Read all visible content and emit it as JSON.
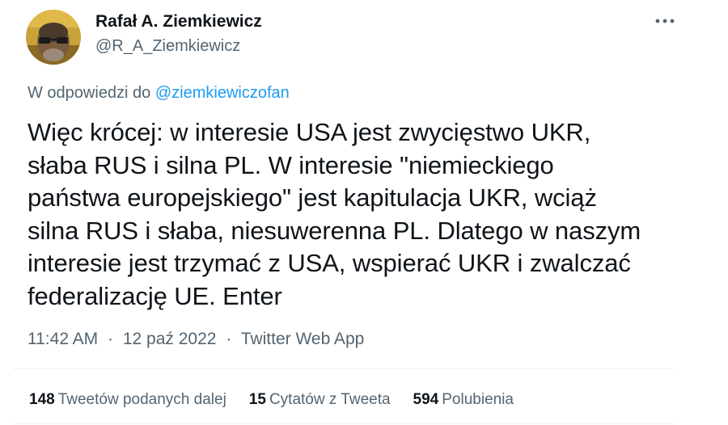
{
  "author": {
    "display_name": "Rafał A. Ziemkiewicz",
    "handle": "@R_A_Ziemkiewicz"
  },
  "reply_context": {
    "prefix": "W odpowiedzi do ",
    "mention": "@ziemkiewiczofan"
  },
  "tweet": {
    "lines": [
      "Więc krócej: w interesie USA jest zwycięstwo UKR,",
      "słaba RUS i silna PL. W interesie \"niemieckiego",
      "państwa europejskiego\" jest kapitulacja UKR, wciąż",
      "silna RUS i słaba, niesuwerenna PL. Dlatego w naszym",
      "interesie jest trzymać z USA, wspierać UKR i zwalczać",
      "federalizację UE. Enter"
    ]
  },
  "meta": {
    "time": "11:42 AM",
    "separator": "·",
    "date": "12 paź 2022",
    "source": "Twitter Web App"
  },
  "stats": {
    "retweets_count": "148",
    "retweets_label": "Tweetów podanych dalej",
    "quotes_count": "15",
    "quotes_label": "Cytatów z Tweeta",
    "likes_count": "594",
    "likes_label": "Polubienia"
  },
  "colors": {
    "text_primary": "#0f1419",
    "text_secondary": "#536471",
    "link": "#1d9bf0",
    "divider": "#eff3f4"
  },
  "icons": {
    "more": "more-horizontal-icon"
  }
}
